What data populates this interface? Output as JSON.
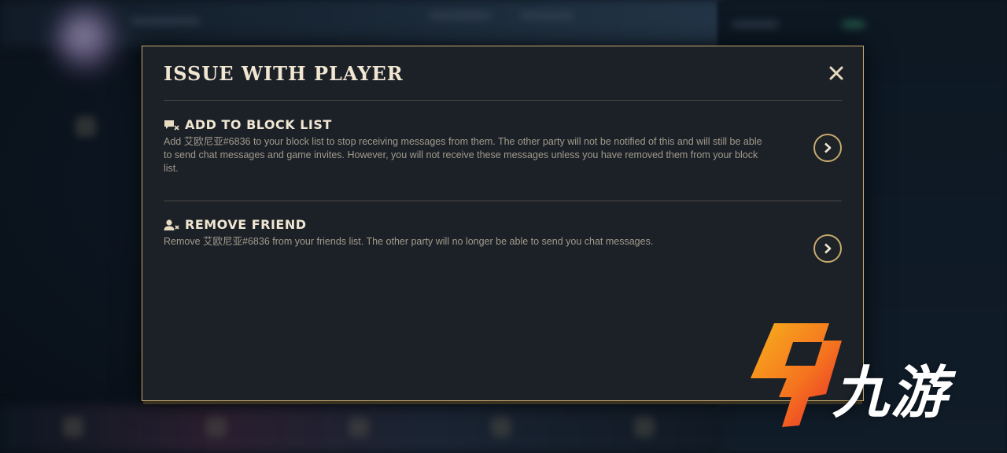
{
  "modal": {
    "title": "ISSUE WITH PLAYER",
    "close_icon": "close-icon"
  },
  "options": [
    {
      "icon": "block-chat-icon",
      "title": "ADD TO BLOCK LIST",
      "description": "Add 艾欧尼亚#6836 to your block list to stop receiving messages from them. The other party will not be notified of this and will still be able to send chat messages and game invites. However, you will not receive these messages unless you have removed them from your block list."
    },
    {
      "icon": "remove-friend-icon",
      "title": "REMOVE FRIEND",
      "description": "Remove 艾欧尼亚#6836 from your friends list. The other party will no longer be able to send you chat messages."
    }
  ],
  "watermark": {
    "text": "九游"
  },
  "colors": {
    "gold": "#c8aa6e",
    "title_text": "#f0e6d2",
    "body_text": "#a09b8c",
    "modal_bg": "#1c2027",
    "logo_orange": "#f7941d",
    "logo_red": "#e8262b"
  }
}
